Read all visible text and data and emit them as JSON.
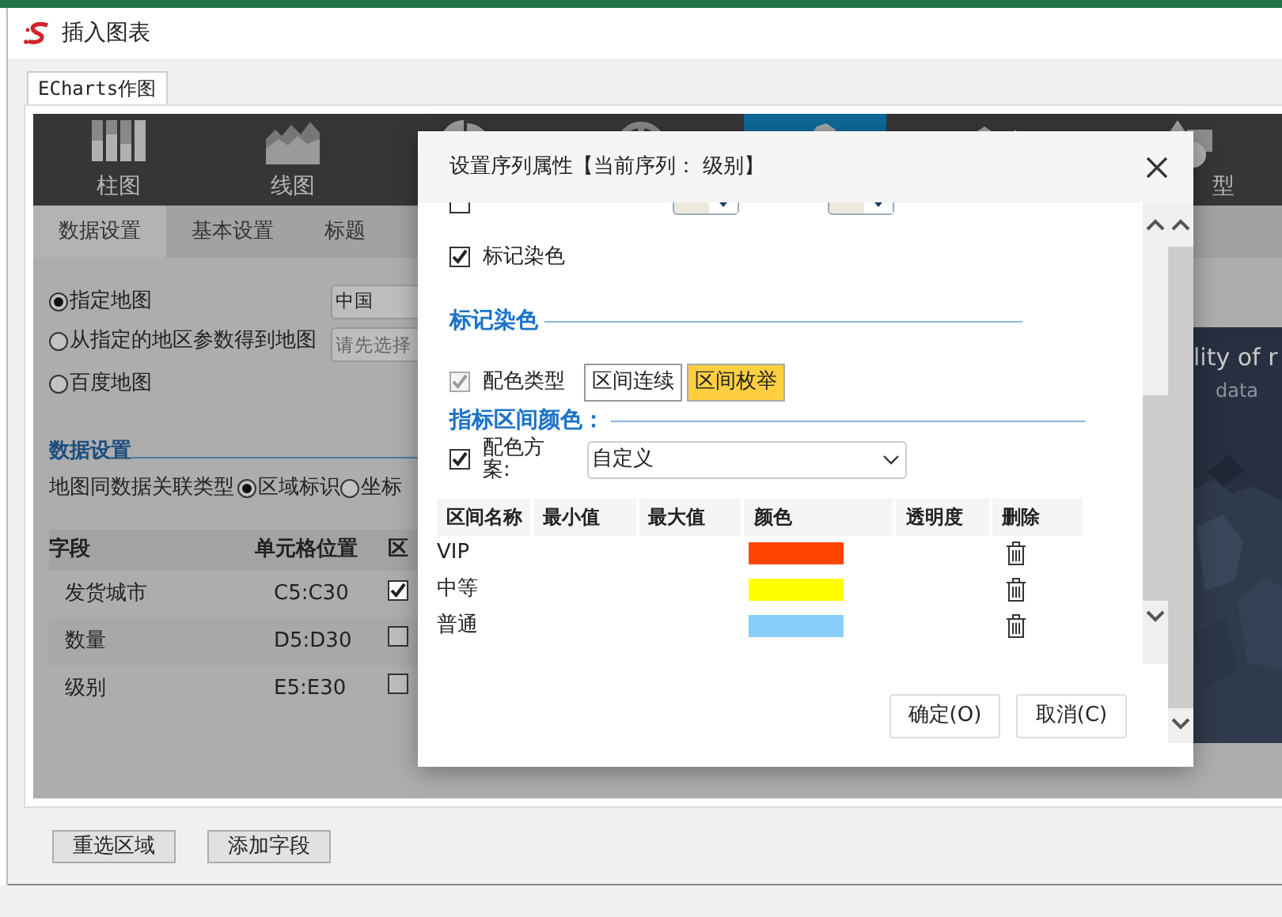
{
  "window": {
    "title": "插入图表"
  },
  "tabs": [
    {
      "label": "ECharts作图",
      "selected": true
    }
  ],
  "chart_types": [
    {
      "kind": "bar",
      "label": "柱图",
      "selected": false
    },
    {
      "kind": "area",
      "label": "线图",
      "selected": false
    },
    {
      "kind": "pie",
      "selected": false
    },
    {
      "kind": "gauge",
      "selected": false
    },
    {
      "kind": "map",
      "selected": true
    },
    {
      "kind": "arrow",
      "selected": false
    },
    {
      "kind": "shapes",
      "label": "型",
      "selected": false
    }
  ],
  "sub_tabs": [
    {
      "label": "数据设置",
      "selected": true
    },
    {
      "label": "基本设置",
      "selected": false
    },
    {
      "label": "标题",
      "selected": false
    }
  ],
  "map_source": [
    {
      "label": "指定地图",
      "selected": true,
      "field": {
        "value": "中国"
      }
    },
    {
      "label": "从指定的地区参数得到地图",
      "selected": false,
      "field": {
        "placeholder": "请先选择"
      }
    },
    {
      "label": "百度地图",
      "selected": false
    }
  ],
  "data_settings": {
    "title": "数据设置",
    "link_label": "地图同数据关联类型",
    "link_options": [
      {
        "label": "区域标识",
        "selected": true
      },
      {
        "label": "坐标",
        "selected": false
      }
    ],
    "columns": [
      "字段",
      "单元格位置",
      "区"
    ],
    "rows": [
      {
        "field": "发货城市",
        "cells": "C5:C30",
        "checked": true
      },
      {
        "field": "数量",
        "cells": "D5:D30",
        "checked": false
      },
      {
        "field": "级别",
        "cells": "E5:E30",
        "checked": false
      }
    ]
  },
  "preview": {
    "title": "lity of r",
    "subtitle": "data",
    "kind": "picture"
  },
  "footer_buttons": [
    "重选区域",
    "添加字段"
  ],
  "dialog": {
    "title": "设置序列属性【当前序列： 级别】",
    "top_row": {
      "checked": false
    },
    "mark_color": {
      "label": "标记染色",
      "checked": true
    },
    "section_1": "标记染色",
    "color_type": {
      "label": "配色类型",
      "checked": true,
      "disabled": true,
      "options": [
        {
          "label": "区间连续",
          "selected": false
        },
        {
          "label": "区间枚举",
          "selected": true
        }
      ]
    },
    "section_2": "指标区间颜色：",
    "scheme": {
      "label": "配色方案:",
      "checked": true,
      "value": "自定义"
    },
    "columns": [
      "区间名称",
      "最小值",
      "最大值",
      "颜色",
      "透明度",
      "删除"
    ],
    "rows": [
      {
        "name": "VIP",
        "color": "#ff4500"
      },
      {
        "name": "中等",
        "color": "#ffff00"
      },
      {
        "name": "普通",
        "color": "#87cefa"
      }
    ],
    "buttons": [
      "确定(O)",
      "取消(C)"
    ]
  }
}
